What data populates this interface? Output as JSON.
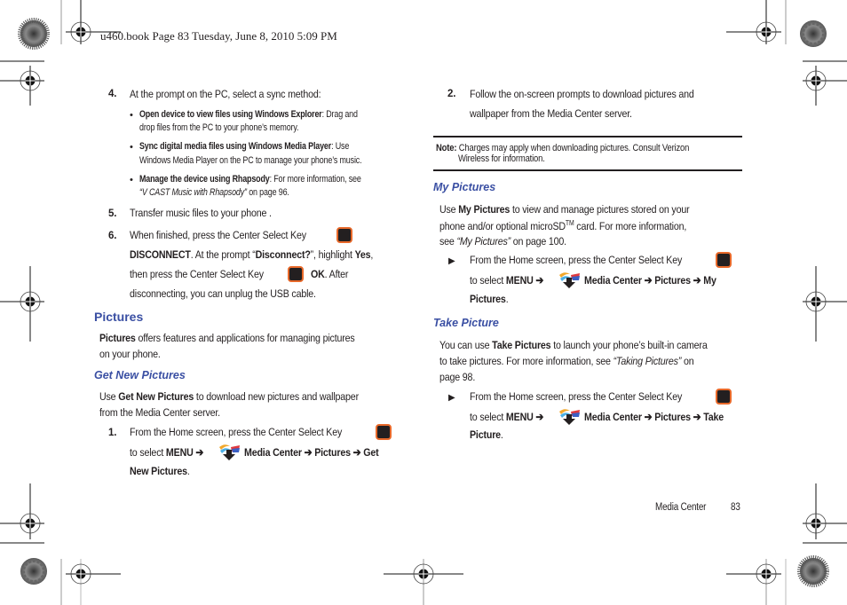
{
  "header": {
    "slug": "u460.book  Page 83  Tuesday, June 8, 2010  5:09 PM"
  },
  "left_column": {
    "step4": {
      "num": "4.",
      "text": "At the prompt on the PC, select a sync method:"
    },
    "bullets": [
      {
        "bold": "Open device to view files using Windows Explorer",
        "text_line1": ": Drag and",
        "text_line2": "drop files from the PC to your phone’s memory."
      },
      {
        "bold": "Sync digital media files using Windows Media Player",
        "text_line1": ": Use",
        "text_line2": "Windows Media Player on the PC to manage your phone’s music."
      },
      {
        "bold": "Manage the device using Rhapsody",
        "text_line1": ": For more information, see",
        "italic": "“V CAST Music with Rhapsody”",
        "text_line2": " on page 96."
      }
    ],
    "step5": {
      "num": "5.",
      "text": "Transfer music files to your phone ."
    },
    "step6": {
      "num": "6.",
      "line1": "When finished, press the Center Select Key",
      "line2_bold": "DISCONNECT",
      "line2_a": ". At the prompt “",
      "line2_bold2": "Disconnect?",
      "line2_b": "”, highlight ",
      "line2_bold3": "Yes",
      "line2_c": ",",
      "line3_a": "then press the Center Select Key",
      "line3_bold": "OK",
      "line3_b": ". After",
      "line4": "disconnecting, you can unplug the USB cable."
    },
    "pictures_heading": "Pictures",
    "pictures_intro_bold": "Pictures",
    "pictures_intro_line1": " offers features and applications for managing pictures",
    "pictures_intro_line2": "on your phone.",
    "get_new_heading": "Get New  Pictures",
    "get_new_line1_a": "Use ",
    "get_new_line1_bold": "Get New Pictures",
    "get_new_line1_b": " to download new pictures and wallpaper",
    "get_new_line2": "from the Media Center server.",
    "step1": {
      "num": "1.",
      "line1": "From the Home screen, press the Center Select Key",
      "line2_a": "to select ",
      "menu": "MENU",
      "arrow": "➔",
      "media_center": "Media Center",
      "pictures": "Pictures",
      "last_line2": "Get",
      "last_line3": "New Pictures",
      "period": "."
    }
  },
  "right_column": {
    "step2": {
      "num": "2.",
      "line1": "Follow the on-screen prompts to download pictures and",
      "line2": "wallpaper from the Media Center server."
    },
    "note": {
      "label": "Note:",
      "line1": " Charges may apply when downloading pictures. Consult Verizon",
      "line2": "Wireless for information."
    },
    "my_pictures_heading": "My Pictures",
    "my_pictures_line1_a": "Use ",
    "my_pictures_line1_bold": "My Pictures",
    "my_pictures_line1_b": " to view and manage pictures stored on your",
    "my_pictures_line2_a": "phone and/or optional microSD",
    "my_pictures_tm": "TM",
    "my_pictures_line2_b": " card. For more information,",
    "my_pictures_line3_a": "see ",
    "my_pictures_line3_italic": "“My Pictures”",
    "my_pictures_line3_b": " on page 100.",
    "my_pictures_step": {
      "line1": "From the Home screen, press the Center Select Key",
      "line2_a": "to select ",
      "menu": "MENU",
      "arrow": "➔",
      "media_center": "Media Center",
      "pictures": "Pictures",
      "last_line2": "My",
      "last_line3": "Pictures",
      "period": "."
    },
    "take_picture_heading": "Take Picture",
    "take_line1_a": "You can use ",
    "take_line1_bold": "Take Pictures",
    "take_line1_b": " to launch your phone’s built-in camera",
    "take_line2_a": "to take pictures. For more information, see ",
    "take_line2_italic": "“Taking Pictures”",
    "take_line2_b": " on",
    "take_line3": "page 98.",
    "take_step": {
      "line1": "From the Home screen, press the Center Select Key",
      "line2_a": "to select ",
      "menu": "MENU",
      "arrow": "➔",
      "media_center": "Media Center",
      "pictures": "Pictures",
      "last_line2": "Take",
      "last_line3": "Picture",
      "period": "."
    },
    "bullet_glyph": "▶"
  },
  "footer": {
    "section": "Media Center",
    "page": "83"
  },
  "colors": {
    "heading_blue": "#3a4fa3",
    "key_orange": "#e8692a",
    "text": "#231f20"
  }
}
